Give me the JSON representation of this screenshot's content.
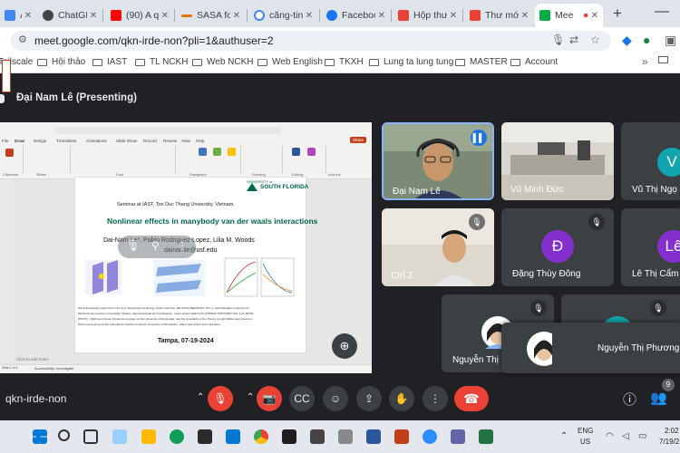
{
  "browser": {
    "tabs": [
      {
        "label": "Ả",
        "fav": "#4285f4"
      },
      {
        "label": "ChatGPT",
        "fav": "#444444"
      },
      {
        "label": "(90) A q",
        "fav": "#ff0000"
      },
      {
        "label": "SASA fo",
        "fav": "#e37400"
      },
      {
        "label": "căng-tin",
        "fav": "#4285f4"
      },
      {
        "label": "Faceboo",
        "fav": "#1877f2"
      },
      {
        "label": "Hộp thư",
        "fav": "#ea4335"
      },
      {
        "label": "Thư mới",
        "fav": "#ea4335"
      },
      {
        "label": "Mee",
        "fav": "#00ac47",
        "active": true
      }
    ],
    "url": "meet.google.com/qkn-irde-non?pli=1&authuser=2",
    "bookmarks": [
      "Tailscale",
      "Hội thảo",
      "IAST",
      "TL NCKH",
      "Web NCKH",
      "Web English",
      "TKXH",
      "Lung ta lung tung",
      "MASTER",
      "Account"
    ]
  },
  "meet": {
    "presenter": "Đại Nam Lê (Presenting)",
    "meeting_code": "qkn-irde-non",
    "participant_count": "9",
    "participants": [
      {
        "name": "Đại Nam Lê",
        "speaking": true
      },
      {
        "name": "Vũ Minh Đức"
      },
      {
        "name": "Vũ Thị Ngọ",
        "initial": "V",
        "color": "#12a4af"
      },
      {
        "name": "Ctrl Z"
      },
      {
        "name": "Đặng Thùy Đông",
        "initial": "Đ",
        "color": "#8430ce"
      },
      {
        "name": "Lê Thị Cẩm T",
        "initial": "Lê",
        "color": "#8430ce"
      },
      {
        "name": "Nguyễn Thị"
      },
      {
        "name": "Nguyễn Thị Phương"
      }
    ]
  },
  "slide": {
    "ribbon_tabs": [
      "File",
      "Home",
      "Insert",
      "Draw",
      "Design",
      "Transitions",
      "Animations",
      "Slide Show",
      "Record",
      "Review",
      "View",
      "Help"
    ],
    "ribbon_groups": [
      "Clipboard",
      "Slides",
      "Font",
      "Paragraph",
      "Drawing",
      "Editing",
      "Add-ins"
    ],
    "share_label": "Share",
    "logo_line1": "UNIVERSITY of",
    "logo_line2": "SOUTH FLORIDA",
    "seminar": "Seminar at IAST, Ton Duc Thang University, Vietnam.",
    "title": "Nonlinear effects in manybody van der waals interactions",
    "authors": "Dai-Nam Le*, Pablo Rodriguez-Lopez, Lilia M. Woods",
    "email": "dainamle@usf.edu",
    "ack_lines": [
      "We acknowledge support from the U.S. Department of Energy under Grant No. DE-FG02-06ER46297. P.R.-L. acknowledges support from",
      "Ministerio de Ciencia e Innovación (Spain), Agencia Estatal de Investigación, under project NaliTUGS (PID2022-136374NB-C21), from RFTi2-",
      "PHOTO, CNRS and Clever Dynamics program at the University of Montpellier, and the hospitality of the Theory of Light-Matter and Quantum",
      "Phenomena group at the Laboratoire Charles Coulomb, University of Montpellier, where part of this work was done."
    ],
    "date": "Tampa, 07-19-2024",
    "notes_hint": "Click to add notes",
    "status_slide": "Slide 1 of 1",
    "status_accessibility": "Accessibility: Investigate"
  },
  "taskbar": {
    "lang1": "ENG",
    "lang2": "US",
    "time": "2:02",
    "date": "7/19/2"
  }
}
